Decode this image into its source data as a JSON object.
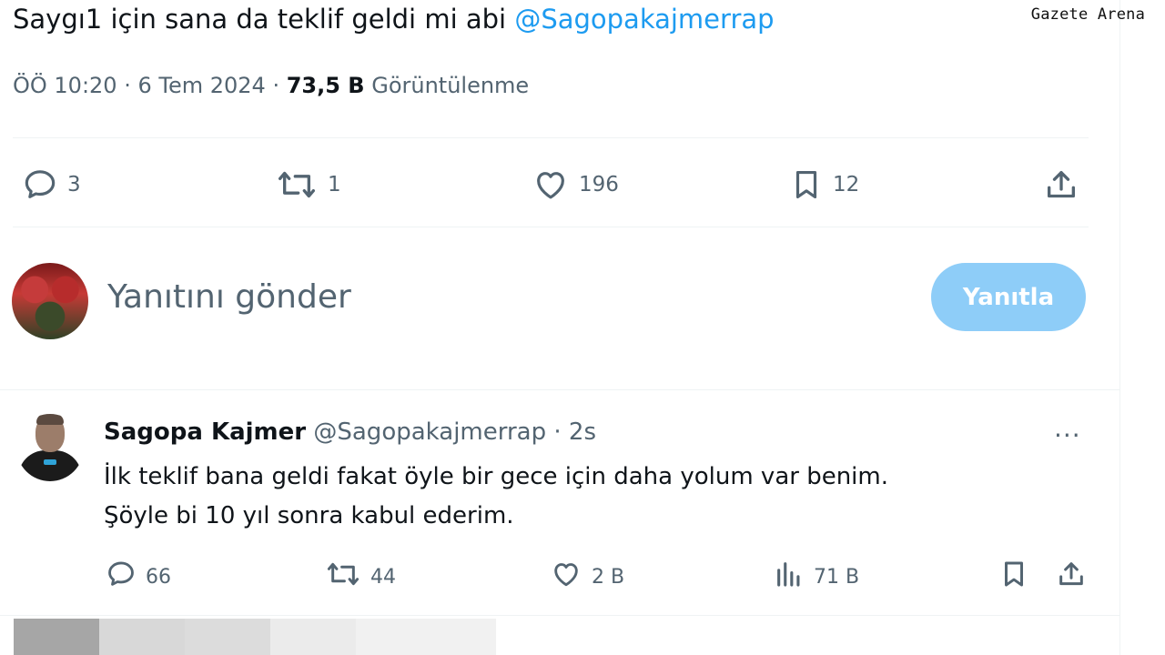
{
  "watermark": "Gazete Arena",
  "tweet": {
    "text_prefix": "Saygı1 için sana da teklif geldi mi abi ",
    "mention": "@Sagopakajmerrap",
    "time": "ÖÖ 10:20",
    "sep": " · ",
    "date": "6 Tem 2024",
    "views_count": "73,5 B",
    "views_label": "Görüntülenme",
    "actions": {
      "replies": "3",
      "retweets": "1",
      "likes": "196",
      "bookmarks": "12"
    }
  },
  "composer": {
    "placeholder": "Yanıtını gönder",
    "button_label": "Yanıtla"
  },
  "reply": {
    "name": "Sagopa Kajmer",
    "handle": "@Sagopakajmerrap",
    "dot": " · ",
    "time": "2s",
    "more": "···",
    "line1": "İlk teklif bana geldi fakat öyle bir gece için daha yolum var benim.",
    "line2": "Şöyle bi 10 yıl sonra kabul ederim.",
    "actions": {
      "replies": "66",
      "retweets": "44",
      "likes": "2 B",
      "views": "71 B"
    }
  },
  "colors": {
    "accent": "#1d9bf0",
    "button": "#8ecdf8",
    "muted": "#536471",
    "text": "#0f1419"
  },
  "icons": [
    "comment-icon",
    "retweet-icon",
    "heart-icon",
    "bookmark-icon",
    "share-icon",
    "views-icon",
    "more-icon"
  ]
}
